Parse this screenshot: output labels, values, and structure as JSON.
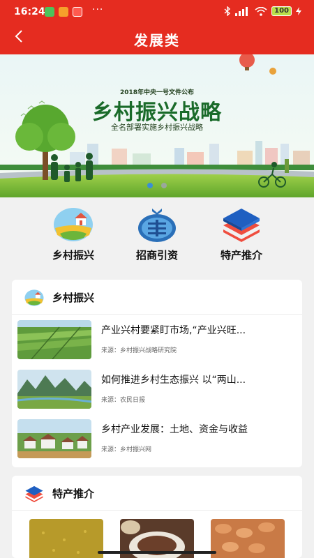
{
  "status": {
    "time": "16:24",
    "dots": "···",
    "battery": "100"
  },
  "header": {
    "title": "发展类"
  },
  "banner": {
    "year_line": "2018年中央一号文件公布",
    "headline": "乡村振兴战略",
    "subline": "全名部署实施乡村振兴战略",
    "page_indicator": {
      "count": 2,
      "active": 0
    }
  },
  "categories": [
    {
      "label": "乡村振兴",
      "icon": "village-icon"
    },
    {
      "label": "招商引资",
      "icon": "investment-icon"
    },
    {
      "label": "特产推介",
      "icon": "layers-icon"
    }
  ],
  "section_rural": {
    "title": "乡村振兴",
    "items": [
      {
        "title": "产业兴村要紧盯市场,“产业兴旺...",
        "source": "来源：乡村振兴战略研究院"
      },
      {
        "title": "如何推进乡村生态振兴 以“两山...",
        "source": "来源：农民日报"
      },
      {
        "title": "乡村产业发展：土地、资金与收益",
        "source": "来源：乡村振兴网"
      }
    ]
  },
  "section_specialty": {
    "title": "特产推介"
  },
  "colors": {
    "brand_red": "#e52c20",
    "active_dot": "#3a8fd6"
  }
}
